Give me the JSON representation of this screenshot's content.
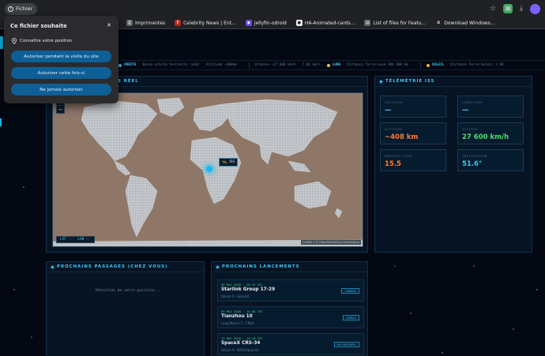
{
  "browser": {
    "site_chip": "Fichier",
    "bookmarks": [
      {
        "icon": "printer-icon",
        "label": "Imprimantes"
      },
      {
        "icon": "celebrity-news-icon",
        "label": "Celebrity News | Ent..."
      },
      {
        "icon": "jellyfin-icon",
        "label": "jellyfin-odroid"
      },
      {
        "icon": "github-icon",
        "label": "HA-Animated-cards..."
      },
      {
        "icon": "bookmark-icon",
        "label": "List of files for Featu..."
      },
      {
        "icon": "windows-icon",
        "label": "Download Windows..."
      }
    ]
  },
  "permission_dialog": {
    "title": "Ce fichier souhaite",
    "request": "Connaître votre position",
    "buttons": [
      "Autoriser pendant la visite du site",
      "Autoriser cette fois-ci",
      "Ne jamais autoriser"
    ]
  },
  "ticker": {
    "orbit_title": "ORBITE",
    "orbit_items": [
      "Basse orbite terrestre (LEO)",
      "Altitude ~408km",
      "Vitesse ~27 600 km/h",
      "7.66 km/s"
    ],
    "moon_title": "LUNE",
    "moon_items": [
      "Distance Terre-Lune 384 400 km"
    ],
    "sun_title": "SOLEIL",
    "sun_items": [
      "Distance Terre-Soleil 1 UA"
    ]
  },
  "map_panel": {
    "title": "... PS RÉEL",
    "lat_label": "LAT --",
    "lon_label": "LON --",
    "iss_label": "ISS",
    "attribution": "Leaflet | © OpenStreetMap contributors",
    "zoom_in": "+",
    "zoom_out": "−"
  },
  "telemetry": {
    "title": "TÉLÉMÉTRIE ISS",
    "cards": [
      {
        "label": "LATITUDE",
        "value": "—",
        "color": "#3ec7f2"
      },
      {
        "label": "LONGITUDE",
        "value": "—",
        "color": "#3ec7f2"
      },
      {
        "label": "ALTITUDE",
        "value": "~408 km",
        "color": "#ff7a2e"
      },
      {
        "label": "VITESSE",
        "value": "27 600 km/h",
        "color": "#45e06a"
      },
      {
        "label": "ORBITES/JOUR",
        "value": "15.5",
        "color": "#ff7a2e"
      },
      {
        "label": "INCLINAISON",
        "value": "51.6°",
        "color": "#3ec7f2"
      }
    ]
  },
  "passes": {
    "title": "PROCHAINS PASSAGES (CHEZ VOUS)",
    "status": "Détection de votre position..."
  },
  "launches": {
    "title": "PROCHAINS LANCEMENTS",
    "items": [
      {
        "date": "05 MAI 2026 · 20:15 UTC",
        "name": "Starlink Group 17-29",
        "rocket": "Falcon 9 · SpaceX",
        "badge": "T-MINUS"
      },
      {
        "date": "09 MAI 2026 · 15:08 UTC",
        "name": "Tianzhou 10",
        "rocket": "Long March 7 · CNSA",
        "badge": "CARGO"
      },
      {
        "date": "12 MAI 2026 · 16:28 UTC",
        "name": "SpaceX CRS-34",
        "rocket": "Falcon 9 · NASA/SpaceX",
        "badge": "ISS RESUPPLY"
      }
    ]
  }
}
